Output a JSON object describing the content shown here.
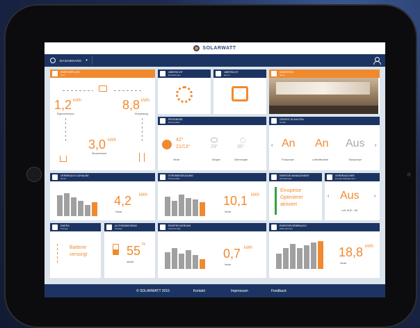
{
  "brand": {
    "name": "SOLARWATT"
  },
  "nav": {
    "dashboard_label": "DASHBOARD"
  },
  "tiles": {
    "energy_flow": {
      "title": "ENERGIEFLUSS",
      "sub": "Jetzt",
      "left_value": "1,2",
      "left_unit": "kWh",
      "left_label": "Eigenverbrauch",
      "right_value": "8,8",
      "right_unit": "kWh",
      "right_label": "Einspeisung",
      "center_value": "3,0",
      "center_unit": "kWh",
      "center_label": "Stromeinkauf"
    },
    "settings": {
      "title": "ÜBERSICHT",
      "sub": "Einstellungen"
    },
    "export": {
      "title": "ÜBERSICHT",
      "sub": "Export"
    },
    "news": {
      "title": "NEWSFEED",
      "sub": "News"
    },
    "forecast": {
      "title": "PROGNOSE",
      "sub": "Photovoltaik",
      "today_temp": "42°",
      "today_range": "21/13°",
      "today_label": "Heute",
      "tomorrow_temp": "29°",
      "tomorrow_label": "Morgen",
      "dayafter_temp": "35°",
      "dayafter_label": "Übermorgen"
    },
    "devices": {
      "title": "GERÄTE SCHALTEN",
      "sub": "Geräte",
      "d1_state": "An",
      "d1_label": "Poolpumpe",
      "d2_state": "An",
      "d2_label": "Luftentfeuchter",
      "d3_state": "Aus",
      "d3_label": "Tischpumpe"
    },
    "consumption": {
      "title": "VERBRAUCH ZUHAUSE",
      "sub": "Heute",
      "value": "4,2",
      "unit": "kWh",
      "label": "Heute"
    },
    "generation": {
      "title": "STROMERZEUGUNG",
      "sub": "Photovoltaik",
      "value": "10,1",
      "unit": "kWh",
      "label": "Heute"
    },
    "energy_mgmt": {
      "title": "ENERGIE MANAGEMENT",
      "sub": "Einstellungen",
      "text1": "Einspeise",
      "text2": "Optimierer",
      "text3": "aktiviert"
    },
    "consumer": {
      "title": "VERBRAUCHER",
      "sub": "Energie Management",
      "state": "Aus",
      "label": "Luft, HGD - WL"
    },
    "battery": {
      "title": "EMERA",
      "sub": "Storage",
      "text1": "Batterie",
      "text2": "versorgt"
    },
    "soc": {
      "title": "AUTONOMIEGRAD",
      "sub": "Storage",
      "value": "55",
      "unit": "%",
      "label": "aktuell"
    },
    "charge": {
      "title": "EINSPEICHERUNG",
      "sub": "Lade Energie",
      "value": "0,7",
      "unit": "kWh",
      "label": "Heute"
    },
    "heat": {
      "title": "ENERGIEVERBRAUCH",
      "sub": "Wärmepumpe",
      "value": "18,8",
      "unit": "kWh",
      "label": "Heute"
    }
  },
  "footer": {
    "copyright": "© SOLARWATT 2015",
    "contact": "Kontakt",
    "impressum": "Impressum",
    "feedback": "Feedback"
  }
}
